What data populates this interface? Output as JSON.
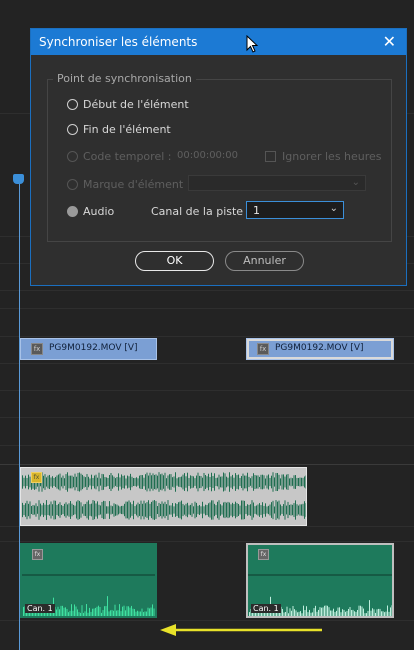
{
  "dialog": {
    "title": "Synchroniser les éléments",
    "close_glyph": "✕",
    "group_label": "Point de synchronisation",
    "options": {
      "start": "Début de l'élément",
      "end": "Fin de l'élément",
      "timecode": "Code temporel :",
      "timecode_value": "00:00:00:00",
      "ignore_hours": "Ignorer les heures",
      "marker": "Marque d'élément",
      "audio": "Audio",
      "channel_label": "Canal de la piste",
      "channel_value": "1"
    },
    "ok": "OK",
    "cancel": "Annuler"
  },
  "timeline": {
    "video_clips": [
      "PG9M0192.MOV [V]",
      "PG9M0192.MOV [V]"
    ],
    "fx_glyph": "fx",
    "channel_label": "Can. 1"
  },
  "colors": {
    "accent": "#1c7ad4",
    "video_clip": "#7b9fd4",
    "audio_green": "#1e7a5c",
    "arrow": "#e8e22a"
  },
  "icons": [
    "close-icon",
    "chevron-down-icon",
    "fx-icon",
    "mouse-cursor-icon",
    "playhead-icon",
    "arrow-left-icon"
  ]
}
